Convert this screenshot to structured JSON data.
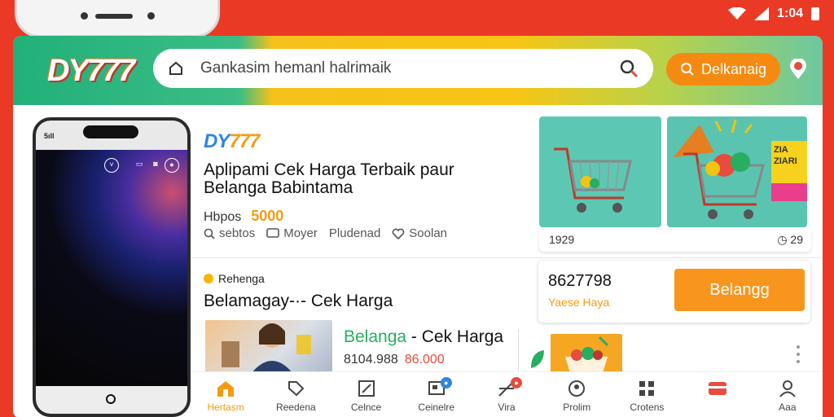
{
  "status": {
    "time": "1:04"
  },
  "header": {
    "logo": "DY777",
    "search_placeholder": "Gankasim hemanl halrimaik",
    "cta_label": "Delkanaig"
  },
  "phone": {
    "signal": "5ıll"
  },
  "product": {
    "logo_a": "DY",
    "logo_b": "777",
    "title": "Aplipami Cek Harga Terbaik paur Belanga Babintama",
    "price_label": "Hbpos",
    "price_value": "5000",
    "actions": [
      "sebtos",
      "Moyer",
      "Pludenad",
      "Soolan"
    ]
  },
  "tiles": {
    "foot_left": "1929",
    "foot_right": "29",
    "badge_text": "ZIA ZIARI"
  },
  "offer": {
    "price": "8627798",
    "note": "Yaese Haya",
    "button": "Belangg"
  },
  "section": {
    "category": "Rehenga",
    "title": "Belamagay-·- Cek Harga"
  },
  "item2": {
    "title_a": "Belanga",
    "title_b": " - Cek Harga",
    "price_old": "8104.988",
    "price_new": "86.000"
  },
  "nav": {
    "items": [
      {
        "label": "Hertasm"
      },
      {
        "label": "Reedena"
      },
      {
        "label": "Celnce"
      },
      {
        "label": "Ceinelre"
      },
      {
        "label": "Vira"
      },
      {
        "label": "Prolim"
      },
      {
        "label": "Crotens"
      },
      {
        "label": ""
      },
      {
        "label": "Aaa"
      }
    ]
  },
  "colors": {
    "accent": "#f39c12",
    "brand_green": "#22b07a",
    "background": "#ea3a26"
  }
}
